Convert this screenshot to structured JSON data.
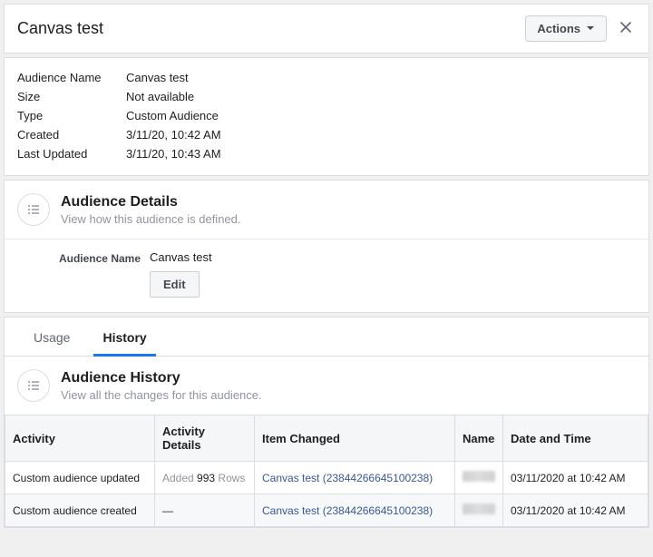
{
  "header": {
    "title": "Canvas test",
    "actions_label": "Actions"
  },
  "summary": {
    "labels": {
      "audience_name": "Audience Name",
      "size": "Size",
      "type": "Type",
      "created": "Created",
      "last_updated": "Last Updated"
    },
    "values": {
      "audience_name": "Canvas test",
      "size": "Not available",
      "type": "Custom Audience",
      "created": "3/11/20, 10:42 AM",
      "last_updated": "3/11/20, 10:43 AM"
    }
  },
  "details": {
    "title": "Audience Details",
    "subtitle": "View how this audience is defined.",
    "label_audience_name": "Audience Name",
    "audience_name": "Canvas test",
    "edit_label": "Edit"
  },
  "tabs": {
    "usage": "Usage",
    "history": "History"
  },
  "history": {
    "title": "Audience History",
    "subtitle": "View all the changes for this audience.",
    "columns": {
      "activity": "Activity",
      "details": "Activity Details",
      "item": "Item Changed",
      "name": "Name",
      "datetime": "Date and Time"
    },
    "rows": [
      {
        "activity": "Custom audience updated",
        "details_prefix": "Added ",
        "details_count": "993",
        "details_suffix": " Rows",
        "item": "Canvas test (23844266645100238)",
        "datetime": "03/11/2020 at 10:42 AM"
      },
      {
        "activity": "Custom audience created",
        "details_plain": "—",
        "item": "Canvas test (23844266645100238)",
        "datetime": "03/11/2020 at 10:42 AM"
      }
    ]
  }
}
